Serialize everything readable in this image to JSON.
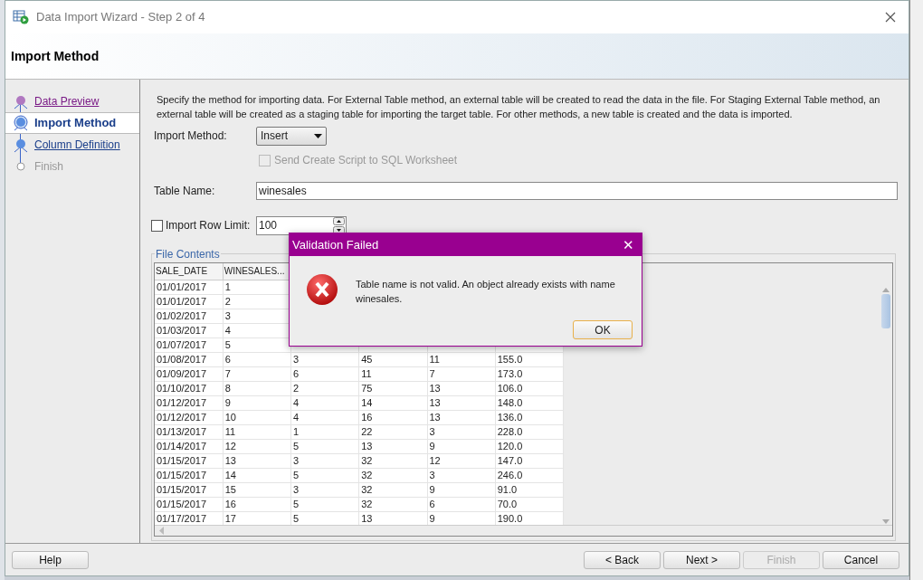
{
  "window": {
    "title": "Data Import Wizard - Step 2 of 4"
  },
  "header": {
    "title": "Import Method"
  },
  "steps": [
    {
      "label": "Data Preview",
      "kind": "visited",
      "selected": false
    },
    {
      "label": "Import Method",
      "kind": "current",
      "selected": true
    },
    {
      "label": "Column Definition",
      "kind": "pending",
      "selected": false
    },
    {
      "label": "Finish",
      "kind": "locked",
      "selected": false
    }
  ],
  "description": "Specify the method for importing data.  For External Table method, an external table will be created to read the data in the file.  For Staging External Table method, an external table will be created as a staging table for importing the target table.  For other methods, a new table is created and the data is imported.",
  "import_method": {
    "label": "Import Method:",
    "value": "Insert"
  },
  "send_script": {
    "label": "Send Create Script to SQL Worksheet",
    "checked": false,
    "disabled": true
  },
  "table_name": {
    "label": "Table Name:",
    "value": "winesales"
  },
  "row_limit": {
    "label": "Import Row Limit:",
    "checked": false,
    "value": "100"
  },
  "file_contents": {
    "title": "File Contents",
    "columns": [
      "SALE_DATE",
      "WINESALES..."
    ],
    "rows": [
      [
        "01/01/2017",
        "1"
      ],
      [
        "01/01/2017",
        "2"
      ],
      [
        "01/02/2017",
        "3"
      ],
      [
        "01/03/2017",
        "4"
      ],
      [
        "01/07/2017",
        "5"
      ],
      [
        "01/08/2017",
        "6",
        "3",
        "45",
        "11",
        "155.0"
      ],
      [
        "01/09/2017",
        "7",
        "6",
        "11",
        "7",
        "173.0"
      ],
      [
        "01/10/2017",
        "8",
        "2",
        "75",
        "13",
        "106.0"
      ],
      [
        "01/12/2017",
        "9",
        "4",
        "14",
        "13",
        "148.0"
      ],
      [
        "01/12/2017",
        "10",
        "4",
        "16",
        "13",
        "136.0"
      ],
      [
        "01/13/2017",
        "11",
        "1",
        "22",
        "3",
        "228.0"
      ],
      [
        "01/14/2017",
        "12",
        "5",
        "13",
        "9",
        "120.0"
      ],
      [
        "01/15/2017",
        "13",
        "3",
        "32",
        "12",
        "147.0"
      ],
      [
        "01/15/2017",
        "14",
        "5",
        "32",
        "3",
        "246.0"
      ],
      [
        "01/15/2017",
        "15",
        "3",
        "32",
        "9",
        "91.0"
      ],
      [
        "01/15/2017",
        "16",
        "5",
        "32",
        "6",
        "70.0"
      ],
      [
        "01/17/2017",
        "17",
        "5",
        "13",
        "9",
        "190.0"
      ]
    ]
  },
  "buttons": [
    {
      "label": "Help",
      "disabled": false,
      "kind": "help"
    },
    {
      "label": "< Back",
      "disabled": false,
      "kind": "nav"
    },
    {
      "label": "Next >",
      "disabled": false,
      "kind": "nav"
    },
    {
      "label": "Finish",
      "disabled": true,
      "kind": "nav"
    },
    {
      "label": "Cancel",
      "disabled": false,
      "kind": "nav"
    }
  ],
  "alert": {
    "title": "Validation Failed",
    "close": "✕",
    "message": "Table name is not valid.  An object already exists with name winesales.",
    "button": "OK"
  }
}
